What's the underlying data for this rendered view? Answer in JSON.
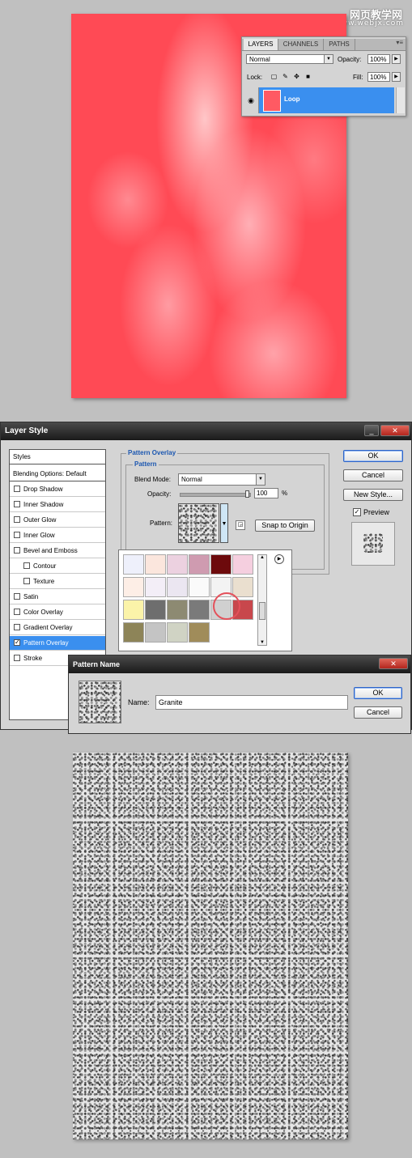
{
  "watermark": {
    "line1": "网页教学网",
    "line2": "www.webjx.com"
  },
  "layers_panel": {
    "tabs": [
      "LAYERS",
      "CHANNELS",
      "PATHS"
    ],
    "blend_mode": "Normal",
    "opacity_label": "Opacity:",
    "opacity_value": "100%",
    "lock_label": "Lock:",
    "fill_label": "Fill:",
    "fill_value": "100%",
    "layer_name": "Loop"
  },
  "layer_style_dialog": {
    "title": "Layer Style",
    "styles_header": "Styles",
    "blending_options": "Blending Options: Default",
    "effects": [
      {
        "label": "Drop Shadow",
        "checked": false,
        "indent": false
      },
      {
        "label": "Inner Shadow",
        "checked": false,
        "indent": false
      },
      {
        "label": "Outer Glow",
        "checked": false,
        "indent": false
      },
      {
        "label": "Inner Glow",
        "checked": false,
        "indent": false
      },
      {
        "label": "Bevel and Emboss",
        "checked": false,
        "indent": false
      },
      {
        "label": "Contour",
        "checked": false,
        "indent": true
      },
      {
        "label": "Texture",
        "checked": false,
        "indent": true
      },
      {
        "label": "Satin",
        "checked": false,
        "indent": false
      },
      {
        "label": "Color Overlay",
        "checked": false,
        "indent": false
      },
      {
        "label": "Gradient Overlay",
        "checked": false,
        "indent": false
      },
      {
        "label": "Pattern Overlay",
        "checked": true,
        "indent": false,
        "selected": true
      },
      {
        "label": "Stroke",
        "checked": false,
        "indent": false
      }
    ],
    "section_title": "Pattern Overlay",
    "subsection_title": "Pattern",
    "blend_mode_label": "Blend Mode:",
    "blend_mode_value": "Normal",
    "opacity_label": "Opacity:",
    "opacity_value": "100",
    "opacity_unit": "%",
    "opacity_slider_level": 1.0,
    "pattern_label": "Pattern:",
    "snap_button": "Snap to Origin",
    "ok_button": "OK",
    "cancel_button": "Cancel",
    "new_style_button": "New Style...",
    "preview_label": "Preview",
    "preview_checked": true,
    "swatch_colors": [
      "#eef0fb",
      "#fbe6dd",
      "#ecd1e0",
      "#cf9bb0",
      "#6d0a0c",
      "#f5cfdf",
      "#fdeee6",
      "#f3eef7",
      "#ebe6f1",
      "#fafafa",
      "#f3f3f3",
      "#eadfcf",
      "#fbf3a9",
      "#6e6e6e",
      "#8d8a72",
      "#7a7a7a",
      "#d0d0d0",
      "#c8474c",
      "#8d8458",
      "#c4c4c4",
      "#d0d3c4",
      "#a08c5a"
    ]
  },
  "pattern_name_dialog": {
    "title": "Pattern Name",
    "name_label": "Name:",
    "name_value": "Granite",
    "ok_button": "OK",
    "cancel_button": "Cancel"
  }
}
